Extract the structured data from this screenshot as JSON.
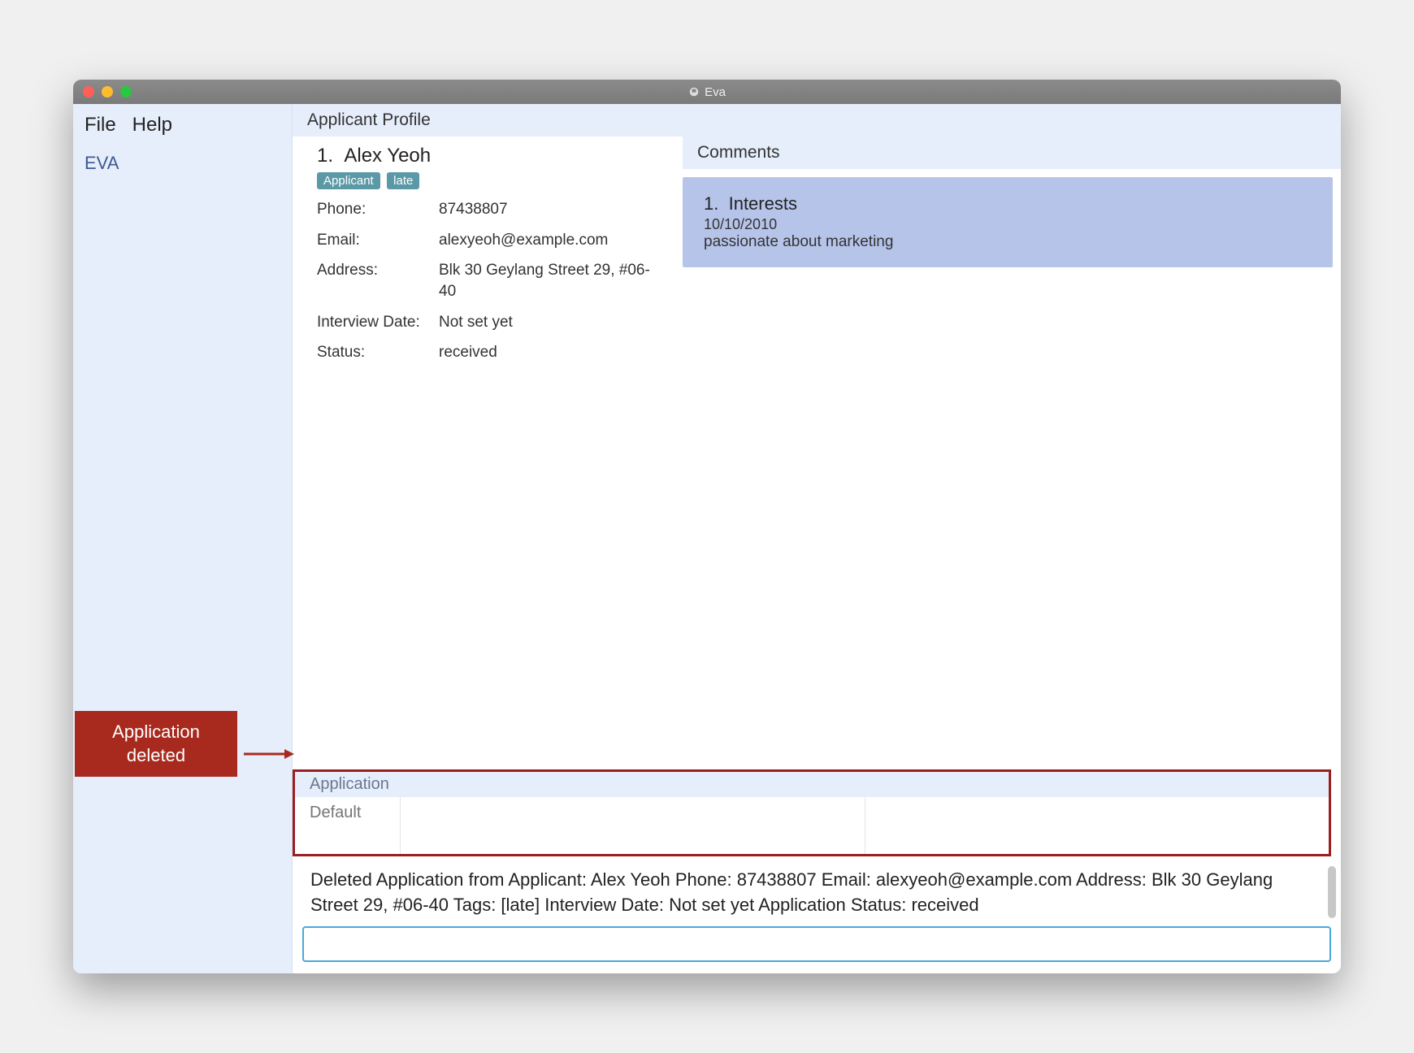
{
  "window": {
    "title": "Eva"
  },
  "menu": {
    "file": "File",
    "help": "Help"
  },
  "brand": "EVA",
  "sections": {
    "profile_header": "Applicant Profile",
    "comments_header": "Comments",
    "application_header": "Application"
  },
  "applicant": {
    "index": "1.",
    "name": "Alex Yeoh",
    "tags": [
      "Applicant",
      "late"
    ],
    "fields": [
      {
        "label": "Phone:",
        "value": "87438807"
      },
      {
        "label": "Email:",
        "value": "alexyeoh@example.com"
      },
      {
        "label": "Address:",
        "value": "Blk 30 Geylang Street 29, #06-40"
      },
      {
        "label": "Interview Date:",
        "value": "Not set yet"
      },
      {
        "label": "Status:",
        "value": "received"
      }
    ]
  },
  "comments": [
    {
      "index": "1.",
      "title": "Interests",
      "date": "10/10/2010",
      "body": "passionate about marketing"
    }
  ],
  "application_row": {
    "col1": "Default",
    "col2": "",
    "col3": ""
  },
  "status_message": "Deleted Application from Applicant: Alex Yeoh Phone: 87438807 Email: alexyeoh@example.com Address: Blk 30 Geylang Street 29, #06-40 Tags: [late] Interview Date: Not set yet Application Status: received",
  "command_input": {
    "value": "",
    "placeholder": ""
  },
  "callout": {
    "line1": "Application",
    "line2": "deleted"
  }
}
